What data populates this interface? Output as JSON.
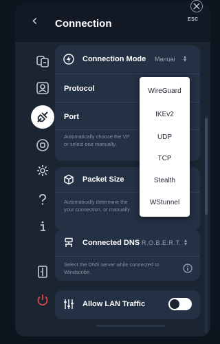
{
  "header": {
    "title": "Connection",
    "esc_label": "ESC"
  },
  "sidebar": {
    "items": [
      {
        "icon": "split-tunnel-icon"
      },
      {
        "icon": "account-icon"
      },
      {
        "icon": "connection-icon",
        "active": true
      },
      {
        "icon": "robert-icon"
      },
      {
        "icon": "gear-icon"
      },
      {
        "icon": "help-icon"
      },
      {
        "icon": "info-icon"
      },
      {
        "icon": "sign-out-icon"
      },
      {
        "icon": "power-icon"
      }
    ]
  },
  "connection_mode": {
    "label": "Connection Mode",
    "value": "Manual",
    "protocol_label": "Protocol",
    "port_label": "Port",
    "description": "Automatically choose the VP\nor select one manually."
  },
  "packet_size": {
    "label": "Packet Size",
    "description": "Automatically determine the\nyour connection, or manually"
  },
  "connected_dns": {
    "label": "Connected DNS",
    "value": "R.O.B.E.R.T.",
    "description": "Select the DNS server while connected to\nWindscribe."
  },
  "lan_traffic": {
    "label": "Allow LAN Traffic",
    "enabled": true
  },
  "protocol_dropdown": {
    "options": [
      "WireGuard",
      "IKEv2",
      "UDP",
      "TCP",
      "Stealth",
      "WStunnel"
    ]
  },
  "colors": {
    "background": "#0e141d",
    "panel": "#1b2431",
    "card": "#243043",
    "power_red": "#e04848"
  }
}
